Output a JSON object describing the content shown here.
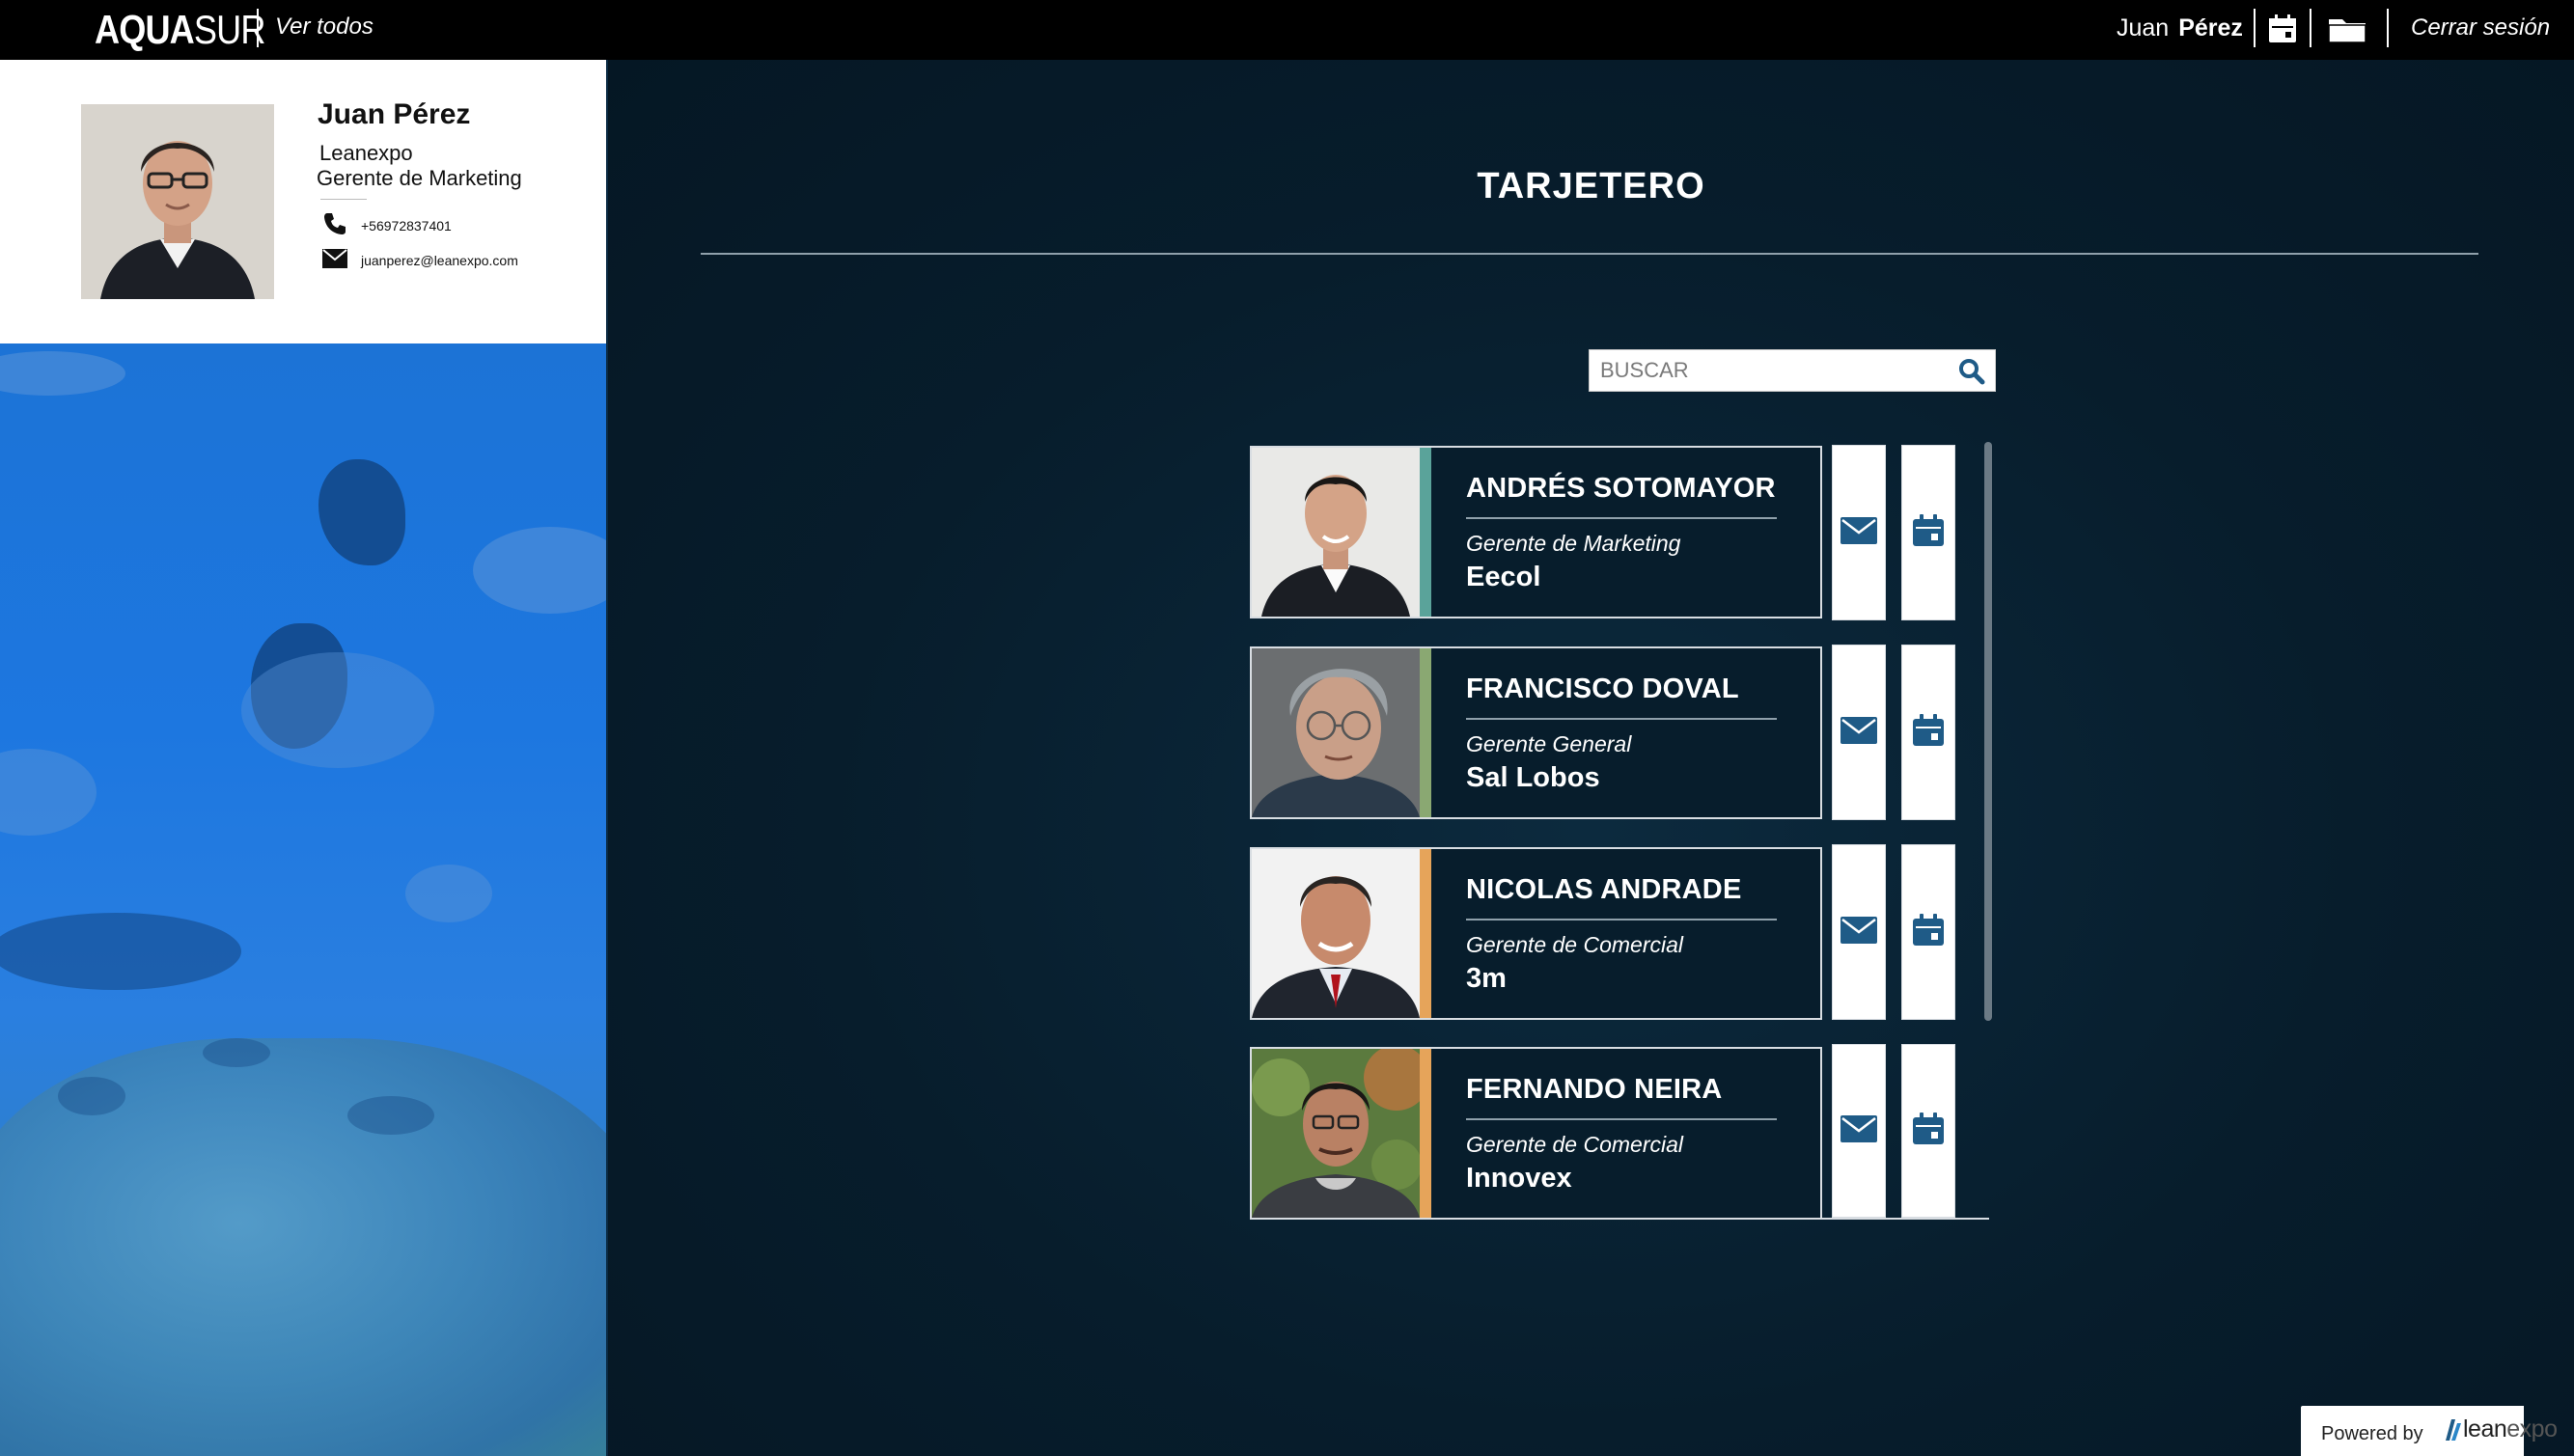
{
  "header": {
    "brand_left": "AQUA",
    "brand_right": "SUR",
    "ver_todos": "Ver todos",
    "user_first": "Juan",
    "user_last": "Pérez",
    "calendar_icon": "calendar-icon",
    "folder_icon": "folder-icon",
    "logout": "Cerrar sesión"
  },
  "profile": {
    "name": "Juan Pérez",
    "company": "Leanexpo",
    "role": "Gerente de Marketing",
    "phone": "+56972837401",
    "email": "juanperez@leanexpo.com"
  },
  "main": {
    "title": "TARJETERO",
    "search_placeholder": "BUSCAR"
  },
  "contacts": [
    {
      "name": "ANDRÉS SOTOMAYOR",
      "role": "Gerente de Marketing",
      "company": "Eecol",
      "accent": "#5aa39a"
    },
    {
      "name": "FRANCISCO DOVAL",
      "role": "Gerente General",
      "company": "Sal Lobos",
      "accent": "#8aa872"
    },
    {
      "name": "NICOLAS ANDRADE",
      "role": "Gerente de Comercial",
      "company": "3m",
      "accent": "#e6a45a"
    },
    {
      "name": "FERNANDO NEIRA",
      "role": "Gerente de Comercial",
      "company": "Innovex",
      "accent": "#e6a45a"
    }
  ],
  "footer": {
    "powered_by": "Powered by",
    "logo_lean": "lean",
    "logo_expo": "expo"
  },
  "colors": {
    "icon_blue": "#1f5b87",
    "background": "#062032"
  }
}
